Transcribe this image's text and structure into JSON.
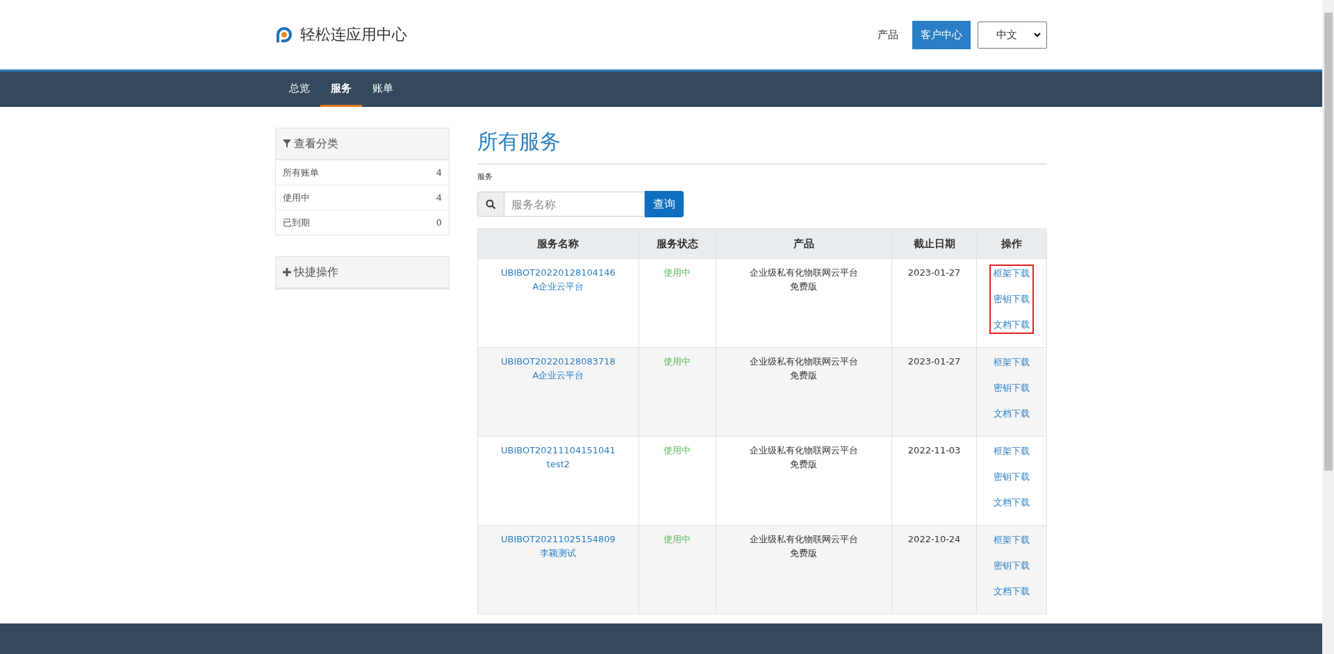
{
  "brand": {
    "name": "轻松连应用中心"
  },
  "header_nav": [
    {
      "label": "产品",
      "kind": "link"
    },
    {
      "label": "客户中心",
      "kind": "button"
    }
  ],
  "language_select": {
    "value": "中文"
  },
  "tabs": [
    {
      "label": "总览",
      "selected": false
    },
    {
      "label": "服务",
      "selected": true
    },
    {
      "label": "账单",
      "selected": false
    }
  ],
  "sidebar": {
    "filter_panel": {
      "title": "查看分类",
      "items": [
        {
          "label": "所有账单",
          "count": "4"
        },
        {
          "label": "使用中",
          "count": "4"
        },
        {
          "label": "已到期",
          "count": "0"
        }
      ]
    },
    "quick_panel": {
      "title": "快捷操作"
    }
  },
  "main": {
    "title": "所有服务",
    "breadcrumb": "服务",
    "search": {
      "placeholder": "服务名称",
      "button": "查询"
    },
    "table": {
      "columns": [
        "服务名称",
        "服务状态",
        "产品",
        "截止日期",
        "操作"
      ],
      "rows": [
        {
          "id": "UBIBOT20220128104146",
          "name": "A企业云平台",
          "status": "使用中",
          "product": "企业级私有化物联网云平台",
          "edition": "免费版",
          "date": "2023-01-27",
          "actions": [
            "框架下载",
            "密钥下载",
            "文档下载"
          ],
          "highlighted": true
        },
        {
          "id": "UBIBOT20220128083718",
          "name": "A企业云平台",
          "status": "使用中",
          "product": "企业级私有化物联网云平台",
          "edition": "免费版",
          "date": "2023-01-27",
          "actions": [
            "框架下载",
            "密钥下载",
            "文档下载"
          ],
          "highlighted": false
        },
        {
          "id": "UBIBOT20211104151041",
          "name": "test2",
          "status": "使用中",
          "product": "企业级私有化物联网云平台",
          "edition": "免费版",
          "date": "2022-11-03",
          "actions": [
            "框架下载",
            "密钥下载",
            "文档下载"
          ],
          "highlighted": false
        },
        {
          "id": "UBIBOT20211025154809",
          "name": "李颖测试",
          "status": "使用中",
          "product": "企业级私有化物联网云平台",
          "edition": "免费版",
          "date": "2022-10-24",
          "actions": [
            "框架下载",
            "密钥下载",
            "文档下载"
          ],
          "highlighted": false
        }
      ]
    }
  }
}
